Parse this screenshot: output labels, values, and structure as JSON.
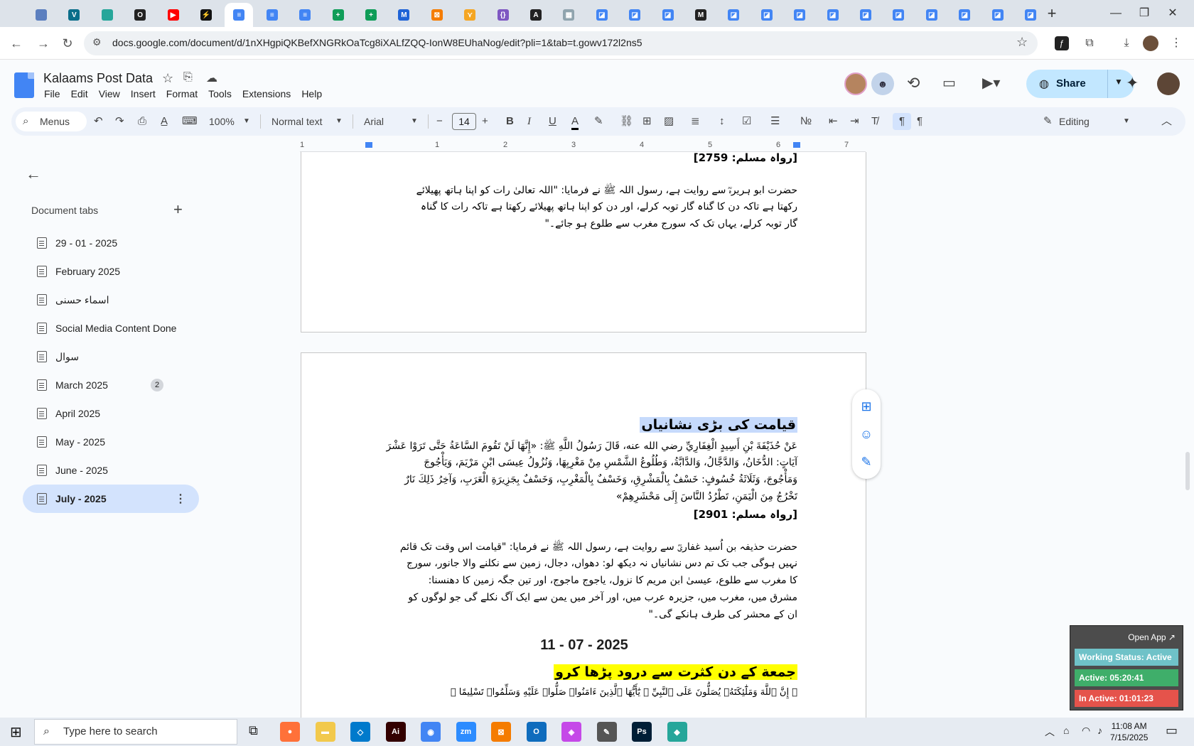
{
  "browser": {
    "url": "docs.google.com/document/d/1nXHgpiQKBefXNGRkOaTcg8iXALfZQQ-IonW8EUhaNog/edit?pli=1&tab=t.gowv172l2ns5",
    "new_tab_symbol": "+",
    "tab_favicons": [
      {
        "color": "#5b7fbf",
        "letter": ""
      },
      {
        "color": "#0b6e8a",
        "letter": "V"
      },
      {
        "color": "#26a69a",
        "letter": ""
      },
      {
        "color": "#222222",
        "letter": "O"
      },
      {
        "color": "#ff0000",
        "letter": "▶"
      },
      {
        "color": "#111111",
        "letter": "⚡"
      },
      {
        "color": "#4285f4",
        "letter": "≡"
      },
      {
        "color": "#4285f4",
        "letter": "≡"
      },
      {
        "color": "#4285f4",
        "letter": "≡"
      },
      {
        "color": "#0f9d58",
        "letter": "+"
      },
      {
        "color": "#0f9d58",
        "letter": "+"
      },
      {
        "color": "#1e63d6",
        "letter": "M"
      },
      {
        "color": "#f57c00",
        "letter": "⊠"
      },
      {
        "color": "#f5a623",
        "letter": "⋎"
      },
      {
        "color": "#7e57c2",
        "letter": "{}"
      },
      {
        "color": "#222222",
        "letter": "A"
      },
      {
        "color": "#90a4ae",
        "letter": "▦"
      },
      {
        "color": "#4285f4",
        "letter": "◪"
      },
      {
        "color": "#4285f4",
        "letter": "◪"
      },
      {
        "color": "#4285f4",
        "letter": "◪"
      },
      {
        "color": "#222222",
        "letter": "M"
      },
      {
        "color": "#4285f4",
        "letter": "◪"
      },
      {
        "color": "#4285f4",
        "letter": "◪"
      },
      {
        "color": "#4285f4",
        "letter": "◪"
      },
      {
        "color": "#4285f4",
        "letter": "◪"
      },
      {
        "color": "#4285f4",
        "letter": "◪"
      },
      {
        "color": "#4285f4",
        "letter": "◪"
      },
      {
        "color": "#4285f4",
        "letter": "◪"
      },
      {
        "color": "#4285f4",
        "letter": "◪"
      },
      {
        "color": "#4285f4",
        "letter": "◪"
      },
      {
        "color": "#4285f4",
        "letter": "◪"
      }
    ]
  },
  "docs": {
    "title": "Kalaams Post Data",
    "menus": [
      "File",
      "Edit",
      "View",
      "Insert",
      "Format",
      "Tools",
      "Extensions",
      "Help"
    ],
    "share_label": "Share",
    "toolbar": {
      "menus_search": "Menus",
      "zoom": "100%",
      "style": "Normal text",
      "font": "Arial",
      "font_size": "14",
      "mode": "Editing"
    },
    "ruler_numbers": [
      "1",
      "1",
      "2",
      "3",
      "4",
      "5",
      "6",
      "7"
    ]
  },
  "sidebar": {
    "heading": "Document tabs",
    "add_symbol": "+",
    "tabs": [
      {
        "label": "29 - 01 - 2025",
        "badge": "",
        "selected": false
      },
      {
        "label": "February 2025",
        "badge": "",
        "selected": false
      },
      {
        "label": "اسماء حسنی",
        "badge": "",
        "selected": false
      },
      {
        "label": "Social Media Content Done",
        "badge": "",
        "selected": false
      },
      {
        "label": "سوال",
        "badge": "",
        "selected": false
      },
      {
        "label": "March 2025",
        "badge": "2",
        "selected": false
      },
      {
        "label": "April 2025",
        "badge": "",
        "selected": false
      },
      {
        "label": "May - 2025",
        "badge": "",
        "selected": false
      },
      {
        "label": "June - 2025",
        "badge": "",
        "selected": false
      },
      {
        "label": "July - 2025",
        "badge": "",
        "selected": true
      }
    ]
  },
  "page1": {
    "ref_top": "[رواہ مسلم: 2759]",
    "lines": [
      "حضرت ابو ہریرہؓ سے روایت ہے، رسول اللہ ﷺ نے فرمایا: \"اللہ تعالیٰ رات کو اپنا ہاتھ پھیلائے",
      "رکھتا ہے تاکہ دن کا گناہ گار توبہ کرلے، اور دن کو اپنا ہاتھ پھیلائے رکھتا ہے تاکہ رات کا گناہ",
      "گار توبہ کرلے، یہاں تک کہ سورج مغرب سے طلوع ہو جائے۔\""
    ]
  },
  "page2": {
    "heading": "قیامت کی بڑی نشانیاں",
    "arabic_lines": [
      "عَنْ حُذَيْفَةَ بْنِ أَسِيدٍ الْغِفَارِيِّ رضي الله عنه، قَالَ رَسُولُ اللَّهِ ﷺ: «إِنَّهَا لَنْ تَقُومَ السَّاعَةُ حَتَّى تَرَوْا عَشْرَ",
      "آيَاتٍ: الدُّخَانُ، وَالدَّجَّالُ، وَالدَّابَّةُ، وَطُلُوعُ الشَّمْسِ مِنْ مَغْرِبِهَا، وَنُزُولُ عِيسَى ابْنِ مَرْيَمَ، وَيَأْجُوجَ",
      "وَمَأْجُوجَ، وَثَلَاثَةُ خُسُوفٍ: خَسْفٌ بِالْمَشْرِقِ، وَخَسْفٌ بِالْمَغْرِبِ، وَخَسْفٌ بِجَزِيرَةِ الْعَرَبِ، وَآخِرُ ذَلِكَ نَارٌ",
      "تَخْرُجُ مِنَ الْيَمَنِ، تَطْرُدُ النَّاسَ إِلَى مَحْشَرِهِمْ»"
    ],
    "reference": "[رواہ مسلم: 2901]",
    "urdu_lines": [
      "حضرت حذیفہ بن اُسید غفاریؓ سے روایت ہے، رسول اللہ ﷺ نے فرمایا: \"قیامت اس وقت تک قائم",
      "نہیں ہوگی جب تک تم دس نشانیاں نہ دیکھ لو: دھواں، دجال، زمین سے نکلنے والا جانور، سورج",
      "کا مغرب سے طلوع، عیسیٰ ابن مریم کا نزول، یاجوج ماجوج، اور تین جگہ زمین کا دھنسنا:",
      "مشرق میں، مغرب میں، جزیرہ عرب میں، اور آخر میں یمن سے ایک آگ نکلے گی جو لوگوں کو",
      "ان کے محشر کی طرف ہانکے گی۔\""
    ],
    "date": "11 - 07 - 2025",
    "friday_heading": "جمعة کے دن کثرت سے درود پڑھا کرو",
    "quran_line": "﴿ إِنَّ ٱللَّهَ وَمَلَٰٓئِكَتَهُۥ يُصَلُّونَ عَلَى ٱلنَّبِيِّ ۚ يَٰٓأَيُّهَا ٱلَّذِينَ ءَامَنُوا۟ صَلُّوا۟ عَلَيْهِ وَسَلِّمُوا۟ تَسْلِيمًا ﴾"
  },
  "status_widget": {
    "open_app": "Open App ↗",
    "working": "Working Status: Active",
    "active": "Active: 05:20:41",
    "inactive": "In Active: 01:01:23",
    "colors": {
      "working": "#6fc2c8",
      "active": "#3fae6a",
      "inactive": "#e5534b"
    }
  },
  "taskbar": {
    "search_placeholder": "Type here to search",
    "time": "11:08 AM",
    "date": "7/15/2025",
    "apps": [
      {
        "color": "#ff7139",
        "letter": "●"
      },
      {
        "color": "#f2c94c",
        "letter": "▬"
      },
      {
        "color": "#007acc",
        "letter": "◇"
      },
      {
        "color": "#330000",
        "letter": "Ai"
      },
      {
        "color": "#4285f4",
        "letter": "◉"
      },
      {
        "color": "#2d8cff",
        "letter": "zm"
      },
      {
        "color": "#f57c00",
        "letter": "⊠"
      },
      {
        "color": "#0f6cbd",
        "letter": "O"
      },
      {
        "color": "#c548e8",
        "letter": "◈"
      },
      {
        "color": "#555555",
        "letter": "✎"
      },
      {
        "color": "#001e36",
        "letter": "Ps"
      },
      {
        "color": "#26a69a",
        "letter": "◆"
      }
    ]
  }
}
